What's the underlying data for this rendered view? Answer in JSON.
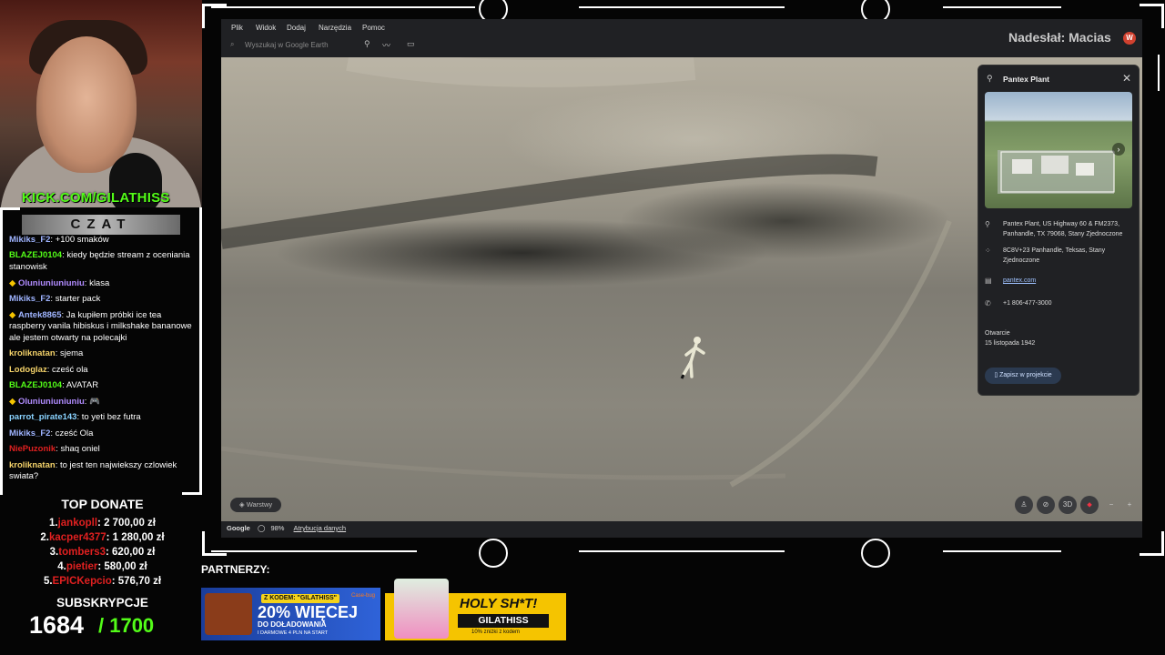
{
  "stream": {
    "kick_url": "KICK.COM/GILATHISS",
    "chat_title": "CZAT",
    "chat_messages": [
      {
        "user": "Mikiks_F2",
        "color": "#9fb4ff",
        "text": "+100 smaków"
      },
      {
        "user": "BLAZEJ0104",
        "color": "#53fc18",
        "text": "kiedy będzie stream z oceniania stanowisk"
      },
      {
        "user": "Oluniuniuniuniu",
        "color": "#b18cff",
        "text": "klasa",
        "badges": true
      },
      {
        "user": "Mikiks_F2",
        "color": "#9fb4ff",
        "text": "starter pack"
      },
      {
        "user": "Antek8865",
        "color": "#9fb4ff",
        "text": "Ja kupiłem próbki ice tea raspberry vanila hibiskus i milkshake bananowe ale jestem otwarty na polecajki",
        "badges": true
      },
      {
        "user": "kroliknatan",
        "color": "#f5d36a",
        "text": "sjema"
      },
      {
        "user": "Lodoglaz",
        "color": "#f5d36a",
        "text": "cześć ola"
      },
      {
        "user": "BLAZEJ0104",
        "color": "#53fc18",
        "text": "AVATAR"
      },
      {
        "user": "Oluniuniuniuniu",
        "color": "#b18cff",
        "text": "🎮",
        "badges": true
      },
      {
        "user": "parrot_pirate143",
        "color": "#8ad3ff",
        "text": "to yeti bez futra"
      },
      {
        "user": "Mikiks_F2",
        "color": "#9fb4ff",
        "text": "cześć Ola"
      },
      {
        "user": "NiePuzonik",
        "color": "#e02020",
        "text": "shaq oniel"
      },
      {
        "user": "kroliknatan",
        "color": "#f5d36a",
        "text": "to jest ten najwiekszy czlowiek swiata?"
      }
    ],
    "top_donate_title": "TOP DONATE",
    "top_donate": [
      {
        "rank": "1.",
        "name": "jankopll",
        "amount": ": 2 700,00 zł"
      },
      {
        "rank": "2.",
        "name": "kacper4377",
        "amount": ": 1 280,00 zł"
      },
      {
        "rank": "3.",
        "name": "tombers3",
        "amount": ": 620,00 zł"
      },
      {
        "rank": "4.",
        "name": "pietier",
        "amount": ": 580,00 zł"
      },
      {
        "rank": "5.",
        "name": "EPICKepcio",
        "amount": ": 576,70 zł"
      }
    ],
    "subs_title": "SUBSKRYPCJE",
    "subs_count": "1684",
    "subs_goal": "/ 1700",
    "partners_label": "PARTNERZY:",
    "banner1": {
      "badge": "Z KODEM: \"GILATHISS\"",
      "big": "20% WIĘCEJ",
      "line1": "DO DOŁADOWANIA",
      "line2": "I DARMOWE 4 PLN NA START",
      "logo": "Case-bug"
    },
    "banner2": {
      "title": "HOLY SH*T!",
      "code": "GILATHISS",
      "sub": "10% zniżki z kodem"
    }
  },
  "earth": {
    "menu": [
      "Plik",
      "Widok",
      "Dodaj",
      "Narzędzia",
      "Pomoc"
    ],
    "search_placeholder": "Wyszukaj w Google Earth",
    "sender": "Nadesłał: Macias",
    "avatar_letter": "W",
    "layers_label": "Warstwy",
    "controls": {
      "view3d": "3D"
    },
    "status": {
      "google": "Google",
      "zoom": "98%",
      "attribution": "Atrybucja danych"
    },
    "panel": {
      "title": "Pantex Plant",
      "address": "Pantex Plant, US Highway 60 & FM2373, Panhandle, TX 79068, Stany Zjednoczone",
      "plus_code": "8C8V+23 Panhandle, Teksas, Stany Zjednoczone",
      "website": "pantex.com",
      "phone": "+1 806-477-3000",
      "opened_label": "Otwarcie",
      "opened_date": "15 listopada 1942",
      "save_label": "Zapisz w projekcie"
    }
  }
}
